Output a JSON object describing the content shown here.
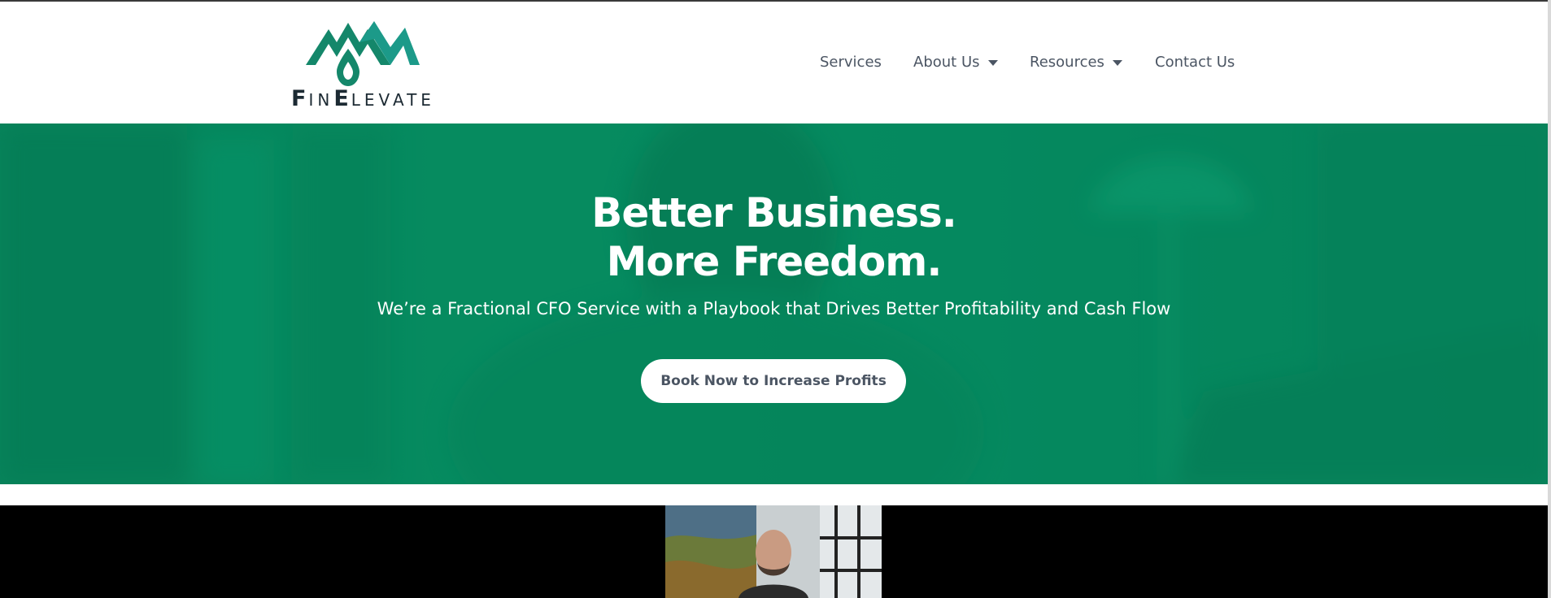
{
  "brand": {
    "name_first": "F",
    "name_rest1": "IN",
    "name_cap2": "E",
    "name_rest2": "LEVATE",
    "primary_color": "#0e8a61",
    "mark_color": "#14876a"
  },
  "nav": {
    "items": [
      {
        "label": "Services",
        "has_dropdown": false
      },
      {
        "label": "About Us",
        "has_dropdown": true
      },
      {
        "label": "Resources",
        "has_dropdown": true
      },
      {
        "label": "Contact Us",
        "has_dropdown": false
      }
    ]
  },
  "hero": {
    "title_line1": "Better Business.",
    "title_line2": "More Freedom.",
    "subtitle": "We’re a Fractional CFO Service with a Playbook that Drives Better Profitability and Cash Flow",
    "cta_label": "Book Now to Increase Profits"
  },
  "video": {
    "icon": "video-thumbnail"
  }
}
